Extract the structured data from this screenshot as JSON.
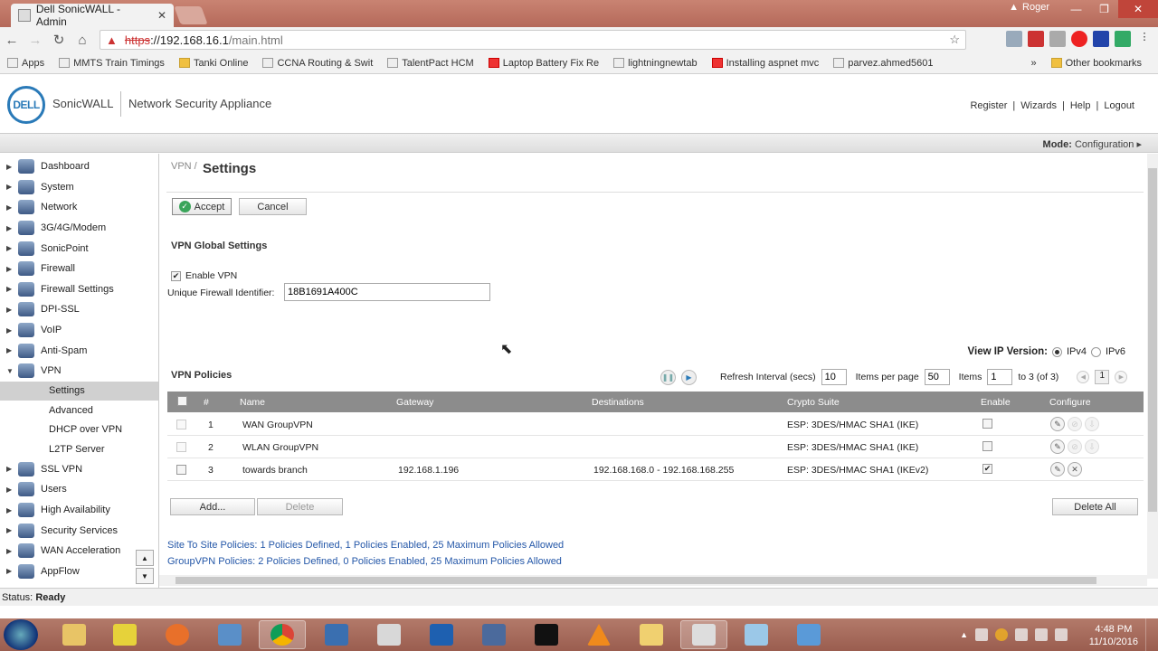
{
  "browser": {
    "tab_title": "Dell SonicWALL - Admin",
    "tab_close": "✕",
    "user": "Roger",
    "url_proto": "https",
    "url_host": "://192.168.16.1",
    "url_path": "/main.html",
    "bookmarks": [
      "Apps",
      "MMTS Train Timings",
      "Tanki Online",
      "CCNA Routing & Swit",
      "TalentPact HCM",
      "Laptop Battery Fix Re",
      "lightningnewtab",
      "Installing aspnet mvc",
      "parvez.ahmed5601"
    ],
    "overflow": "»",
    "other_bookmarks": "Other bookmarks"
  },
  "header": {
    "logo": "DELL",
    "brand": "SonicWALL",
    "product": "Network Security Appliance",
    "links": [
      "Register",
      "|",
      "Wizards",
      "|",
      "Help",
      "|",
      "Logout"
    ],
    "mode_label": "Mode:",
    "mode_value": "Configuration ▸"
  },
  "sidebar": {
    "items": [
      "Dashboard",
      "System",
      "Network",
      "3G/4G/Modem",
      "SonicPoint",
      "Firewall",
      "Firewall Settings",
      "DPI-SSL",
      "VoIP",
      "Anti-Spam",
      "VPN"
    ],
    "vpn_sub": [
      "Settings",
      "Advanced",
      "DHCP over VPN",
      "L2TP Server"
    ],
    "items_after": [
      "SSL VPN",
      "Users",
      "High Availability",
      "Security Services",
      "WAN Acceleration",
      "AppFlow"
    ]
  },
  "main": {
    "breadcrumb": "VPN /",
    "title": "Settings",
    "accept": "Accept",
    "cancel": "Cancel",
    "global_title": "VPN Global Settings",
    "enable_vpn": "Enable VPN",
    "ufid_label": "Unique Firewall Identifier:",
    "ufid_value": "18B1691A400C",
    "ip_version_label": "View IP Version:",
    "ipv4": "IPv4",
    "ipv6": "IPv6",
    "policies_title": "VPN Policies",
    "refresh_label": "Refresh Interval (secs)",
    "refresh_value": "10",
    "ipp_label": "Items per page",
    "ipp_value": "50",
    "items_label": "Items",
    "items_value": "1",
    "items_range": "to 3 (of 3)",
    "page": "1",
    "columns": [
      "#",
      "Name",
      "Gateway",
      "Destinations",
      "Crypto Suite",
      "Enable",
      "Configure"
    ],
    "rows": [
      {
        "num": "1",
        "name": "WAN GroupVPN",
        "gateway": "",
        "dest": "",
        "crypto": "ESP: 3DES/HMAC SHA1 (IKE)",
        "enabled": false
      },
      {
        "num": "2",
        "name": "WLAN GroupVPN",
        "gateway": "",
        "dest": "",
        "crypto": "ESP: 3DES/HMAC SHA1 (IKE)",
        "enabled": false
      },
      {
        "num": "3",
        "name": "towards branch",
        "gateway": "192.168.1.196",
        "dest": "192.168.168.0 - 192.168.168.255",
        "crypto": "ESP: 3DES/HMAC SHA1 (IKEv2)",
        "enabled": true
      }
    ],
    "add": "Add...",
    "delete": "Delete",
    "delete_all": "Delete All",
    "info1": "Site To Site Policies: 1 Policies Defined, 1 Policies Enabled, 25 Maximum Policies Allowed",
    "info2": "GroupVPN Policies: 2 Policies Defined, 0 Policies Enabled, 25 Maximum Policies Allowed"
  },
  "status": {
    "label": "Status:",
    "value": "Ready"
  },
  "taskbar": {
    "time": "4:48 PM",
    "date": "11/10/2016"
  },
  "colors": {
    "accent": "#2a7ab8",
    "table_header": "#8c8c8c",
    "link": "#2457a8"
  }
}
